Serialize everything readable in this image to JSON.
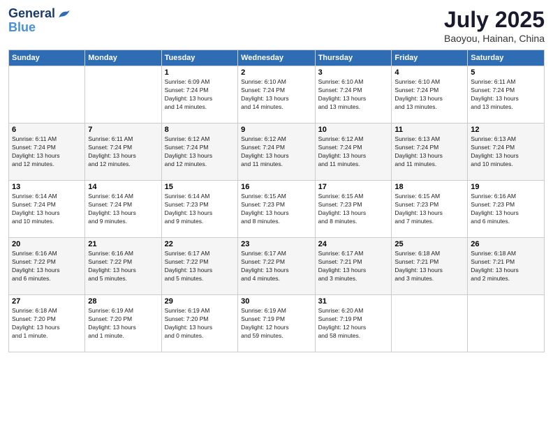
{
  "logo": {
    "line1": "General",
    "line2": "Blue"
  },
  "title": "July 2025",
  "subtitle": "Baoyou, Hainan, China",
  "days_header": [
    "Sunday",
    "Monday",
    "Tuesday",
    "Wednesday",
    "Thursday",
    "Friday",
    "Saturday"
  ],
  "weeks": [
    [
      {
        "day": "",
        "info": ""
      },
      {
        "day": "",
        "info": ""
      },
      {
        "day": "1",
        "info": "Sunrise: 6:09 AM\nSunset: 7:24 PM\nDaylight: 13 hours\nand 14 minutes."
      },
      {
        "day": "2",
        "info": "Sunrise: 6:10 AM\nSunset: 7:24 PM\nDaylight: 13 hours\nand 14 minutes."
      },
      {
        "day": "3",
        "info": "Sunrise: 6:10 AM\nSunset: 7:24 PM\nDaylight: 13 hours\nand 13 minutes."
      },
      {
        "day": "4",
        "info": "Sunrise: 6:10 AM\nSunset: 7:24 PM\nDaylight: 13 hours\nand 13 minutes."
      },
      {
        "day": "5",
        "info": "Sunrise: 6:11 AM\nSunset: 7:24 PM\nDaylight: 13 hours\nand 13 minutes."
      }
    ],
    [
      {
        "day": "6",
        "info": "Sunrise: 6:11 AM\nSunset: 7:24 PM\nDaylight: 13 hours\nand 12 minutes."
      },
      {
        "day": "7",
        "info": "Sunrise: 6:11 AM\nSunset: 7:24 PM\nDaylight: 13 hours\nand 12 minutes."
      },
      {
        "day": "8",
        "info": "Sunrise: 6:12 AM\nSunset: 7:24 PM\nDaylight: 13 hours\nand 12 minutes."
      },
      {
        "day": "9",
        "info": "Sunrise: 6:12 AM\nSunset: 7:24 PM\nDaylight: 13 hours\nand 11 minutes."
      },
      {
        "day": "10",
        "info": "Sunrise: 6:12 AM\nSunset: 7:24 PM\nDaylight: 13 hours\nand 11 minutes."
      },
      {
        "day": "11",
        "info": "Sunrise: 6:13 AM\nSunset: 7:24 PM\nDaylight: 13 hours\nand 11 minutes."
      },
      {
        "day": "12",
        "info": "Sunrise: 6:13 AM\nSunset: 7:24 PM\nDaylight: 13 hours\nand 10 minutes."
      }
    ],
    [
      {
        "day": "13",
        "info": "Sunrise: 6:14 AM\nSunset: 7:24 PM\nDaylight: 13 hours\nand 10 minutes."
      },
      {
        "day": "14",
        "info": "Sunrise: 6:14 AM\nSunset: 7:24 PM\nDaylight: 13 hours\nand 9 minutes."
      },
      {
        "day": "15",
        "info": "Sunrise: 6:14 AM\nSunset: 7:23 PM\nDaylight: 13 hours\nand 9 minutes."
      },
      {
        "day": "16",
        "info": "Sunrise: 6:15 AM\nSunset: 7:23 PM\nDaylight: 13 hours\nand 8 minutes."
      },
      {
        "day": "17",
        "info": "Sunrise: 6:15 AM\nSunset: 7:23 PM\nDaylight: 13 hours\nand 8 minutes."
      },
      {
        "day": "18",
        "info": "Sunrise: 6:15 AM\nSunset: 7:23 PM\nDaylight: 13 hours\nand 7 minutes."
      },
      {
        "day": "19",
        "info": "Sunrise: 6:16 AM\nSunset: 7:23 PM\nDaylight: 13 hours\nand 6 minutes."
      }
    ],
    [
      {
        "day": "20",
        "info": "Sunrise: 6:16 AM\nSunset: 7:22 PM\nDaylight: 13 hours\nand 6 minutes."
      },
      {
        "day": "21",
        "info": "Sunrise: 6:16 AM\nSunset: 7:22 PM\nDaylight: 13 hours\nand 5 minutes."
      },
      {
        "day": "22",
        "info": "Sunrise: 6:17 AM\nSunset: 7:22 PM\nDaylight: 13 hours\nand 5 minutes."
      },
      {
        "day": "23",
        "info": "Sunrise: 6:17 AM\nSunset: 7:22 PM\nDaylight: 13 hours\nand 4 minutes."
      },
      {
        "day": "24",
        "info": "Sunrise: 6:17 AM\nSunset: 7:21 PM\nDaylight: 13 hours\nand 3 minutes."
      },
      {
        "day": "25",
        "info": "Sunrise: 6:18 AM\nSunset: 7:21 PM\nDaylight: 13 hours\nand 3 minutes."
      },
      {
        "day": "26",
        "info": "Sunrise: 6:18 AM\nSunset: 7:21 PM\nDaylight: 13 hours\nand 2 minutes."
      }
    ],
    [
      {
        "day": "27",
        "info": "Sunrise: 6:18 AM\nSunset: 7:20 PM\nDaylight: 13 hours\nand 1 minute."
      },
      {
        "day": "28",
        "info": "Sunrise: 6:19 AM\nSunset: 7:20 PM\nDaylight: 13 hours\nand 1 minute."
      },
      {
        "day": "29",
        "info": "Sunrise: 6:19 AM\nSunset: 7:20 PM\nDaylight: 13 hours\nand 0 minutes."
      },
      {
        "day": "30",
        "info": "Sunrise: 6:19 AM\nSunset: 7:19 PM\nDaylight: 12 hours\nand 59 minutes."
      },
      {
        "day": "31",
        "info": "Sunrise: 6:20 AM\nSunset: 7:19 PM\nDaylight: 12 hours\nand 58 minutes."
      },
      {
        "day": "",
        "info": ""
      },
      {
        "day": "",
        "info": ""
      }
    ]
  ]
}
